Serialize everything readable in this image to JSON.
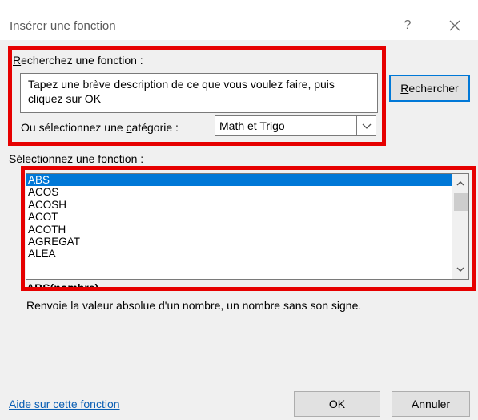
{
  "dialog": {
    "title": "Insérer une fonction",
    "help_glyph": "?",
    "close_icon": "close-icon"
  },
  "search": {
    "label_accel": "R",
    "label_rest": "echerchez une fonction :",
    "input_value": "Tapez une brève description de ce que vous voulez faire, puis cliquez sur OK",
    "button_accel": "R",
    "button_rest": "echercher"
  },
  "category": {
    "label_pre": "Ou sélectionnez une ",
    "label_accel": "c",
    "label_post": "atégorie :",
    "selected": "Math et Trigo"
  },
  "function_list": {
    "label_pre": "Sélectionnez une fo",
    "label_accel": "n",
    "label_post": "ction :",
    "items": [
      "ABS",
      "ACOS",
      "ACOSH",
      "ACOT",
      "ACOTH",
      "AGREGAT",
      "ALEA"
    ],
    "selected_index": 0
  },
  "details": {
    "signature": "ABS(nombre)",
    "description": "Renvoie la valeur absolue d'un nombre, un nombre sans son signe."
  },
  "footer": {
    "help_link": "Aide sur cette fonction",
    "ok_label": "OK",
    "cancel_label": "Annuler"
  },
  "colors": {
    "highlight_box": "#e60000",
    "selection": "#0078d7",
    "link": "#0b5fb4"
  }
}
